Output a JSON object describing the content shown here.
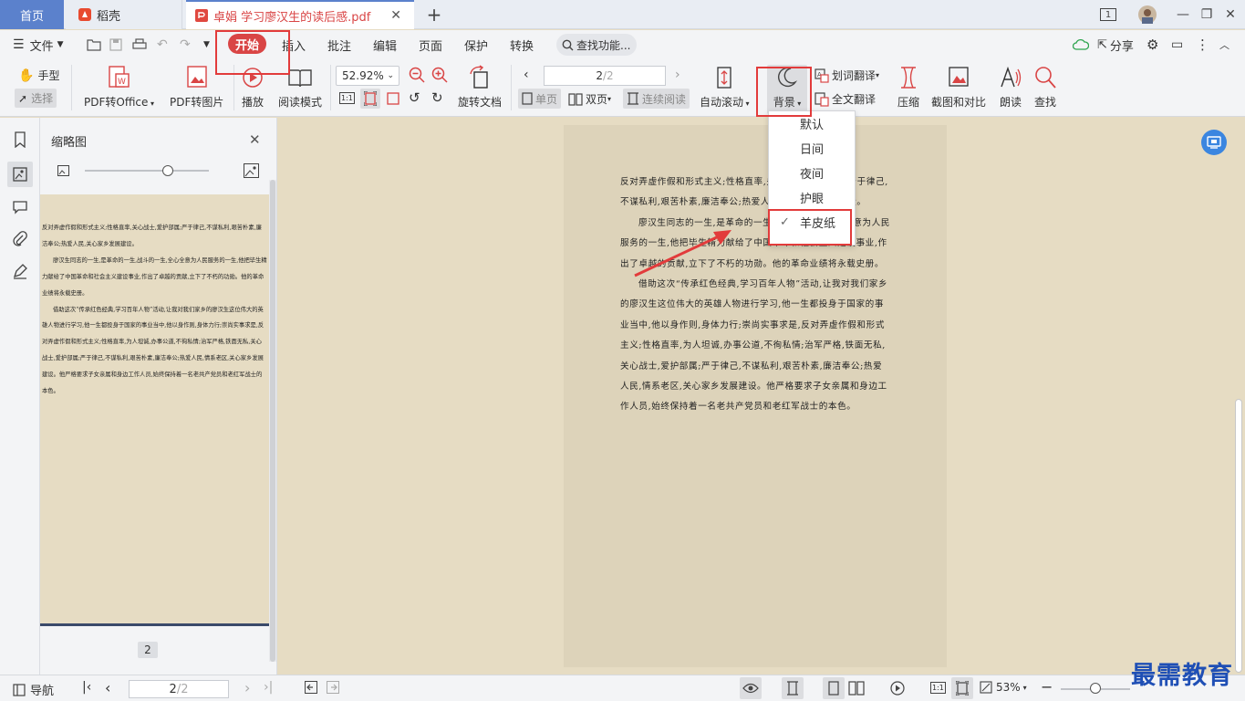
{
  "tabs": {
    "home": "首页",
    "daoke": "稻壳",
    "doc": "卓娟 学习廖汉生的读后感.pdf"
  },
  "window": {
    "page_count_badge": "1"
  },
  "menu": {
    "file": "文件",
    "items": [
      "开始",
      "插入",
      "批注",
      "编辑",
      "页面",
      "保护",
      "转换"
    ],
    "search": "查找功能...",
    "share": "分享"
  },
  "toolbar": {
    "hand": "手型",
    "select": "选择",
    "pdf_to_office": "PDF转Office",
    "pdf_to_image": "PDF转图片",
    "play": "播放",
    "read_mode": "阅读模式",
    "zoom": "52.92%",
    "actual_size": "1:1",
    "rotate_doc": "旋转文档",
    "page_current": "2",
    "page_total": "/2",
    "single_page": "单页",
    "double_page": "双页",
    "continuous": "连续阅读",
    "auto_scroll": "自动滚动",
    "background": "背景",
    "word_translate": "划词翻译",
    "full_translate": "全文翻译",
    "compress": "压缩",
    "screenshot_compare": "截图和对比",
    "read_aloud": "朗读",
    "find": "查找"
  },
  "background_menu": {
    "items": [
      "默认",
      "日间",
      "夜间",
      "护眼",
      "羊皮纸"
    ],
    "checked": "羊皮纸"
  },
  "thumbnail_panel": {
    "title": "缩略图",
    "page_badge": "2"
  },
  "document": {
    "paragraphs": [
      {
        "indent": false,
        "text": "反对弄虚作假和形式主义;性格直率,关心战士,爱护部属;严于律己,不谋私利,艰苦朴素,廉洁奉公;热爱人民,关心家乡发展建设。"
      },
      {
        "indent": true,
        "text": "廖汉生同志的一生,是革命的一生,战斗的一生,全心全意为人民服务的一生,他把毕生精力献给了中国革命和社会主义建设事业,作出了卓越的贡献,立下了不朽的功勋。他的革命业绩将永载史册。"
      },
      {
        "indent": true,
        "text": "借助这次“传承红色经典,学习百年人物”活动,让我对我们家乡的廖汉生这位伟大的英雄人物进行学习,他一生都投身于国家的事业当中,他以身作则,身体力行;崇尚实事求是,反对弄虚作假和形式主义;性格直率,为人坦诚,办事公道,不徇私情;治军严格,铁面无私,关心战士,爱护部属;严于律己,不谋私利,艰苦朴素,廉洁奉公;热爱人民,情系老区,关心家乡发展建设。他严格要求子女亲属和身边工作人员,始终保持着一名老共产党员和老红军战士的本色。"
      }
    ]
  },
  "status": {
    "nav": "导航",
    "page_current": "2",
    "page_total": "/2",
    "zoom": "53%",
    "actual_size": "1:1"
  },
  "watermark": "最需教育",
  "colors": {
    "accent": "#5b81cc",
    "start_button": "#d94545",
    "highlight": "#e23b3b",
    "parchment": "#e6dcc3"
  }
}
